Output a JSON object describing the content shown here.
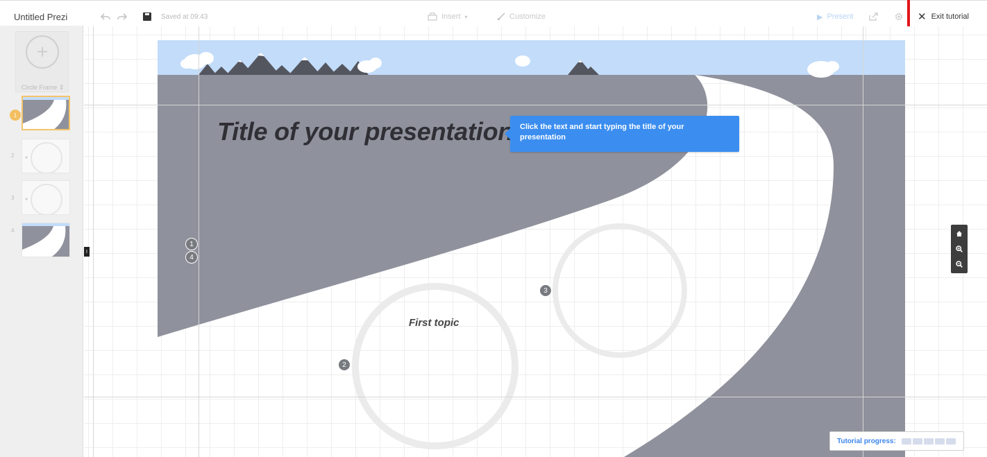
{
  "toolbar": {
    "doc_title": "Untitled Prezi",
    "saved_text": "Saved at 09:43",
    "insert_label": "Insert",
    "customize_label": "Customize",
    "present_label": "Present",
    "exit_label": "Exit tutorial"
  },
  "sidebar": {
    "frame_label": "Circle Frame ⇕",
    "slides": [
      {
        "number": "1"
      },
      {
        "number": "2"
      },
      {
        "number": "3"
      },
      {
        "number": "4"
      }
    ]
  },
  "canvas": {
    "title": "Title of your presentation",
    "tooltip": "Click the text and start typing the title of your presentation",
    "first_topic": "First topic",
    "path_numbers": [
      "1",
      "4",
      "2",
      "3"
    ],
    "edge_handle": "I"
  },
  "progress": {
    "label": "Tutorial progress:",
    "steps_total": 5,
    "steps_done": 0
  },
  "colors": {
    "accent": "#3b8ef0",
    "road": "#8f919c",
    "sky": "#c2dcfa",
    "mountain": "#54565f",
    "highlight": "#e2141a"
  }
}
